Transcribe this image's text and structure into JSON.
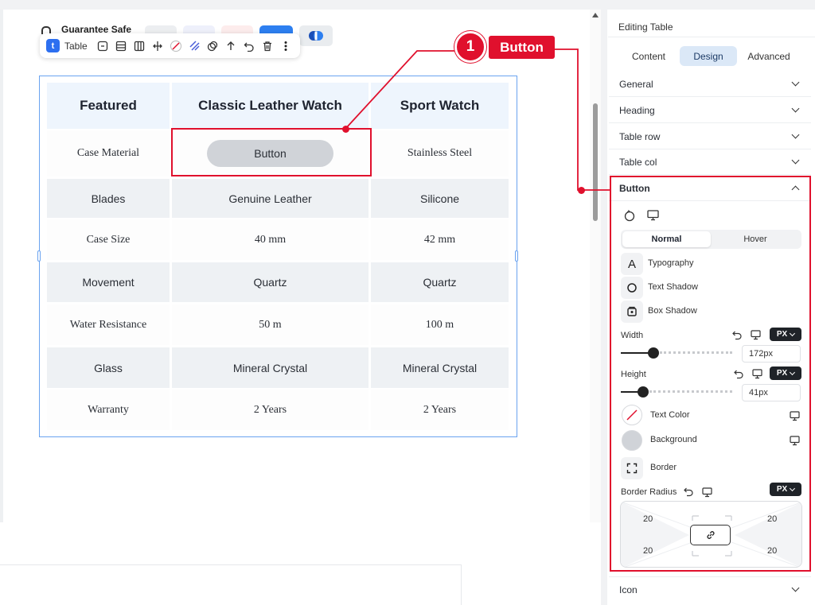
{
  "topbar": {
    "guarantee_text": "Guarantee Safe"
  },
  "toolbar": {
    "badge": "t",
    "label": "Table"
  },
  "table": {
    "headers": [
      "Featured",
      "Classic Leather Watch",
      "Sport Watch"
    ],
    "rows": [
      [
        "Case Material",
        "Button",
        "Stainless Steel"
      ],
      [
        "Blades",
        "Genuine Leather",
        "Silicone"
      ],
      [
        "Case Size",
        "40 mm",
        "42 mm"
      ],
      [
        "Movement",
        "Quartz",
        "Quartz"
      ],
      [
        "Water Resistance",
        "50 m",
        "100 m"
      ],
      [
        "Glass",
        "Mineral Crystal",
        "Mineral Crystal"
      ],
      [
        "Warranty",
        "2 Years",
        "2 Years"
      ]
    ]
  },
  "annotation": {
    "number": "1",
    "label": "Button",
    "color": "#e0102d"
  },
  "panel": {
    "title": "Editing Table",
    "tabs": [
      "Content",
      "Design",
      "Advanced"
    ],
    "active_tab": "Design",
    "sections": [
      "General",
      "Heading",
      "Table row",
      "Table col"
    ],
    "open_section": "Button",
    "last_section": "Icon",
    "state_tabs": [
      "Normal",
      "Hover"
    ],
    "active_state": "Normal",
    "style_rows": [
      "Typography",
      "Text Shadow",
      "Box Shadow"
    ],
    "width": {
      "label": "Width",
      "unit": "PX",
      "value": "172px",
      "fraction": 0.29
    },
    "height": {
      "label": "Height",
      "unit": "PX",
      "value": "41px",
      "fraction": 0.2
    },
    "text_color_label": "Text Color",
    "background_label": "Background",
    "background_color": "#d0d3d8",
    "border_label": "Border",
    "border_radius": {
      "label": "Border Radius",
      "unit": "PX",
      "top_left": "20",
      "top_right": "20",
      "bottom_left": "20",
      "bottom_right": "20"
    }
  }
}
